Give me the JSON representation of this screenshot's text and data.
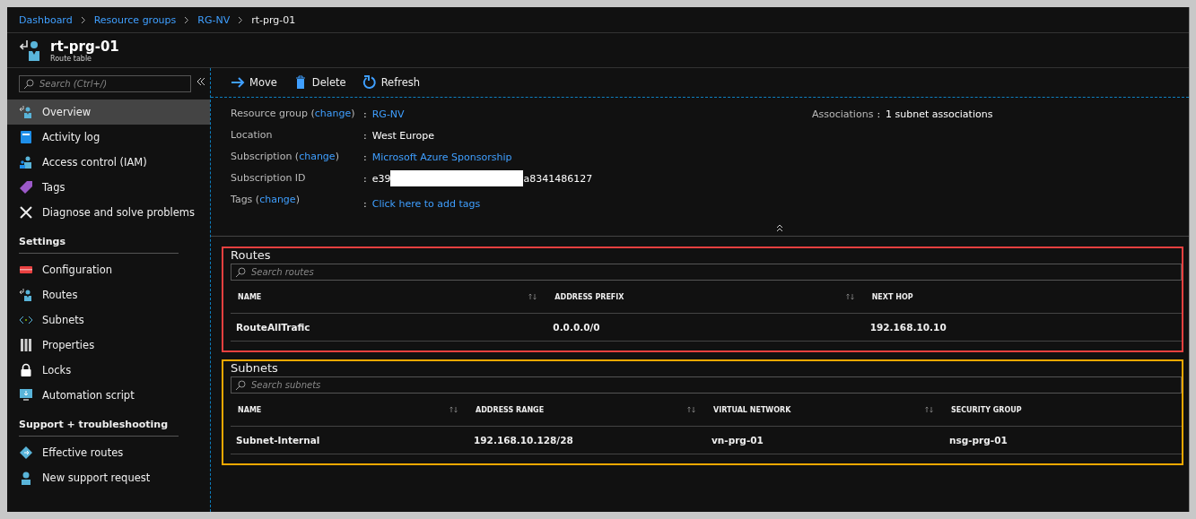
{
  "breadcrumb": [
    {
      "label": "Dashboard",
      "link": true
    },
    {
      "label": "Resource groups",
      "link": true
    },
    {
      "label": "RG-NV",
      "link": true
    },
    {
      "label": "rt-prg-01",
      "link": false
    }
  ],
  "header": {
    "title": "rt-prg-01",
    "subtitle": "Route table"
  },
  "sidebar": {
    "search": {
      "placeholder": "Search (Ctrl+/)"
    },
    "groups": [
      {
        "items": [
          {
            "label": "Overview",
            "kind": "route",
            "selected": true
          },
          {
            "label": "Activity log",
            "kind": "log",
            "selected": false
          },
          {
            "label": "Access control (IAM)",
            "kind": "iam",
            "selected": false
          },
          {
            "label": "Tags",
            "kind": "tag",
            "selected": false
          },
          {
            "label": "Diagnose and solve problems",
            "kind": "tools",
            "selected": false
          }
        ]
      },
      {
        "title": "Settings",
        "items": [
          {
            "label": "Configuration",
            "kind": "config",
            "selected": false
          },
          {
            "label": "Routes",
            "kind": "route",
            "selected": false
          },
          {
            "label": "Subnets",
            "kind": "subnets",
            "selected": false
          },
          {
            "label": "Properties",
            "kind": "properties",
            "selected": false
          },
          {
            "label": "Locks",
            "kind": "lock",
            "selected": false
          },
          {
            "label": "Automation script",
            "kind": "automation",
            "selected": false
          }
        ]
      },
      {
        "title": "Support + troubleshooting",
        "items": [
          {
            "label": "Effective routes",
            "kind": "effective",
            "selected": false
          },
          {
            "label": "New support request",
            "kind": "support",
            "selected": false
          }
        ]
      }
    ]
  },
  "toolbar": [
    {
      "label": "Move",
      "kind": "arrow"
    },
    {
      "label": "Delete",
      "kind": "trash"
    },
    {
      "label": "Refresh",
      "kind": "refresh"
    }
  ],
  "essentials": {
    "rows": [
      {
        "label": "Resource group (",
        "link": "change",
        "label_end": ")",
        "colon": ":",
        "value": "RG-NV",
        "kind": "link"
      },
      {
        "label": "Location",
        "colon": ":",
        "value": "West Europe",
        "kind": "text"
      },
      {
        "label": "Subscription (",
        "link": "change",
        "label_end": ")",
        "colon": ":",
        "value": "Microsoft Azure Sponsorship",
        "kind": "link"
      },
      {
        "label": "Subscription ID",
        "colon": ":",
        "value_parts": [
          "e39",
          "a8341486127"
        ],
        "kind": "redacted"
      },
      {
        "label": "Tags (",
        "link": "change",
        "label_end": ")",
        "colon": ":",
        "value": "Click here to add tags",
        "kind": "link"
      }
    ],
    "right": {
      "label": "Associations",
      "colon": ":",
      "value": "1 subnet associations"
    }
  },
  "sections": [
    {
      "title": "Routes",
      "color": "#e8403f",
      "search": {
        "placeholder": "Search routes"
      },
      "columns": [
        {
          "label": "NAME",
          "sortable": true
        },
        {
          "label": "ADDRESS PREFIX",
          "sortable": true
        },
        {
          "label": "NEXT HOP",
          "sortable": false
        }
      ],
      "rows": [
        [
          "RouteAllTrafic",
          "0.0.0.0/0",
          "192.168.10.10"
        ]
      ]
    },
    {
      "title": "Subnets",
      "color": "#f5a800",
      "search": {
        "placeholder": "Search subnets"
      },
      "columns": [
        {
          "label": "NAME",
          "sortable": true
        },
        {
          "label": "ADDRESS RANGE",
          "sortable": true
        },
        {
          "label": "VIRTUAL NETWORK",
          "sortable": true
        },
        {
          "label": "SECURITY GROUP",
          "sortable": false
        }
      ],
      "rows": [
        [
          "Subnet-Internal",
          "192.168.10.128/28",
          "vn-prg-01",
          "nsg-prg-01"
        ]
      ]
    }
  ]
}
